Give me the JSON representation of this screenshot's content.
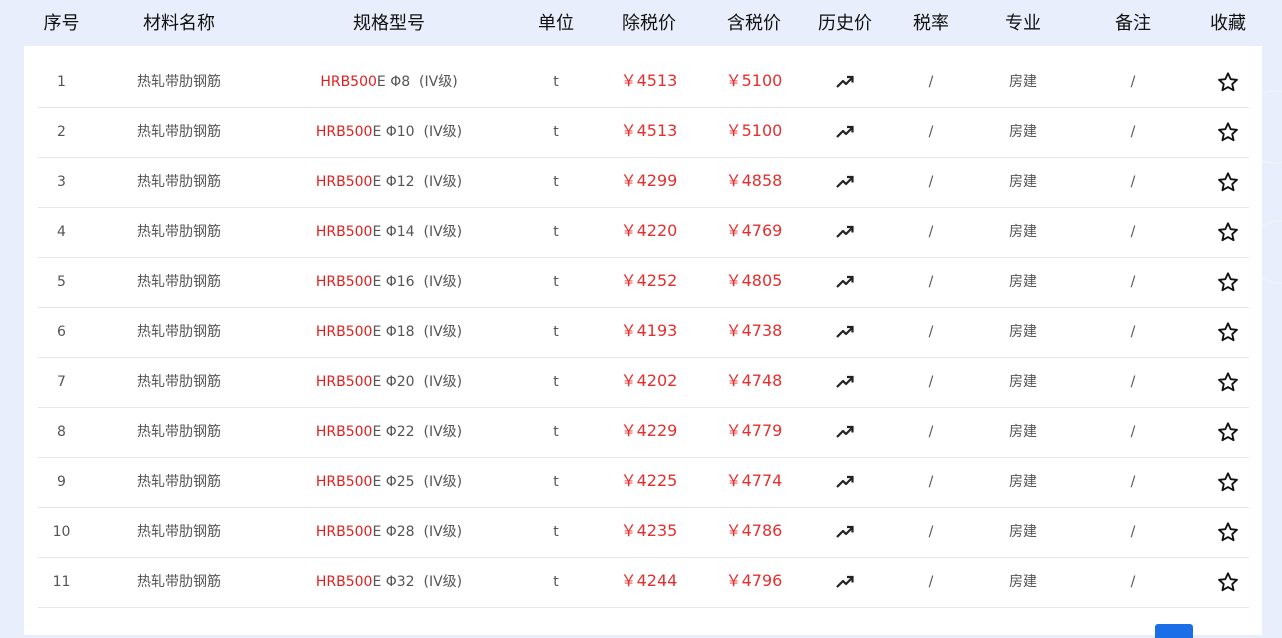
{
  "colors": {
    "accent_red": "#e02020",
    "header_bg": "#e8eefb",
    "pager_blue": "#1a6fe8"
  },
  "header": {
    "index": "序号",
    "name": "材料名称",
    "spec": "规格型号",
    "unit": "单位",
    "price_ex_tax": "除税价",
    "price_inc_tax": "含税价",
    "history": "历史价",
    "tax_rate": "税率",
    "specialty": "专业",
    "remark": "备注",
    "favorite": "收藏"
  },
  "rows": [
    {
      "index": "1",
      "name": "热轧带肋钢筋",
      "spec_code": "HRB500",
      "spec_rest": "E Φ8  (IV级)",
      "unit": "t",
      "price_ex_tax": "￥4513",
      "price_inc_tax": "￥5100",
      "tax_rate": "/",
      "specialty": "房建",
      "remark": "/"
    },
    {
      "index": "2",
      "name": "热轧带肋钢筋",
      "spec_code": "HRB500",
      "spec_rest": "E Φ10  (IV级)",
      "unit": "t",
      "price_ex_tax": "￥4513",
      "price_inc_tax": "￥5100",
      "tax_rate": "/",
      "specialty": "房建",
      "remark": "/"
    },
    {
      "index": "3",
      "name": "热轧带肋钢筋",
      "spec_code": "HRB500",
      "spec_rest": "E Φ12  (IV级)",
      "unit": "t",
      "price_ex_tax": "￥4299",
      "price_inc_tax": "￥4858",
      "tax_rate": "/",
      "specialty": "房建",
      "remark": "/"
    },
    {
      "index": "4",
      "name": "热轧带肋钢筋",
      "spec_code": "HRB500",
      "spec_rest": "E Φ14  (IV级)",
      "unit": "t",
      "price_ex_tax": "￥4220",
      "price_inc_tax": "￥4769",
      "tax_rate": "/",
      "specialty": "房建",
      "remark": "/"
    },
    {
      "index": "5",
      "name": "热轧带肋钢筋",
      "spec_code": "HRB500",
      "spec_rest": "E Φ16  (IV级)",
      "unit": "t",
      "price_ex_tax": "￥4252",
      "price_inc_tax": "￥4805",
      "tax_rate": "/",
      "specialty": "房建",
      "remark": "/"
    },
    {
      "index": "6",
      "name": "热轧带肋钢筋",
      "spec_code": "HRB500",
      "spec_rest": "E Φ18  (IV级)",
      "unit": "t",
      "price_ex_tax": "￥4193",
      "price_inc_tax": "￥4738",
      "tax_rate": "/",
      "specialty": "房建",
      "remark": "/"
    },
    {
      "index": "7",
      "name": "热轧带肋钢筋",
      "spec_code": "HRB500",
      "spec_rest": "E Φ20  (IV级)",
      "unit": "t",
      "price_ex_tax": "￥4202",
      "price_inc_tax": "￥4748",
      "tax_rate": "/",
      "specialty": "房建",
      "remark": "/"
    },
    {
      "index": "8",
      "name": "热轧带肋钢筋",
      "spec_code": "HRB500",
      "spec_rest": "E Φ22  (IV级)",
      "unit": "t",
      "price_ex_tax": "￥4229",
      "price_inc_tax": "￥4779",
      "tax_rate": "/",
      "specialty": "房建",
      "remark": "/"
    },
    {
      "index": "9",
      "name": "热轧带肋钢筋",
      "spec_code": "HRB500",
      "spec_rest": "E Φ25  (IV级)",
      "unit": "t",
      "price_ex_tax": "￥4225",
      "price_inc_tax": "￥4774",
      "tax_rate": "/",
      "specialty": "房建",
      "remark": "/"
    },
    {
      "index": "10",
      "name": "热轧带肋钢筋",
      "spec_code": "HRB500",
      "spec_rest": "E Φ28  (IV级)",
      "unit": "t",
      "price_ex_tax": "￥4235",
      "price_inc_tax": "￥4786",
      "tax_rate": "/",
      "specialty": "房建",
      "remark": "/"
    },
    {
      "index": "11",
      "name": "热轧带肋钢筋",
      "spec_code": "HRB500",
      "spec_rest": "E Φ32  (IV级)",
      "unit": "t",
      "price_ex_tax": "￥4244",
      "price_inc_tax": "￥4796",
      "tax_rate": "/",
      "specialty": "房建",
      "remark": "/"
    }
  ],
  "icons": {
    "history": "trend-up-icon",
    "favorite": "star-outline-icon"
  }
}
